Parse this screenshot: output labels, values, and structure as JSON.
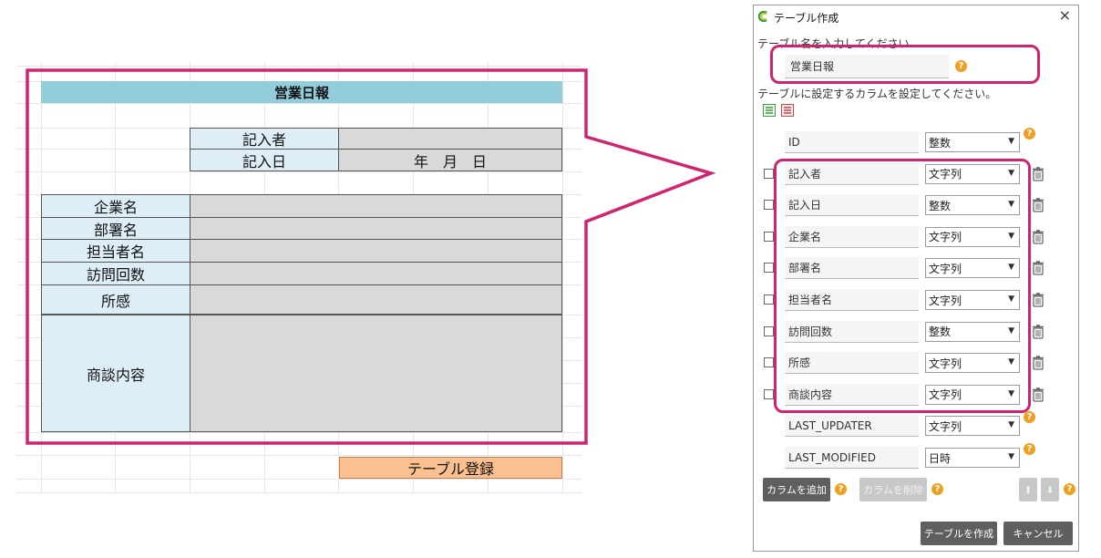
{
  "sheet": {
    "title": "営業日報",
    "recorder_label": "記入者",
    "date_label": "記入日",
    "date_value": "年　月　日",
    "rows": [
      {
        "label": "企業名"
      },
      {
        "label": "部署名"
      },
      {
        "label": "担当者名"
      },
      {
        "label": "訪問回数"
      },
      {
        "label": "所感"
      }
    ],
    "content_label": "商談内容",
    "register_button": "テーブル登録"
  },
  "dialog": {
    "title": "テーブル作成",
    "close_glyph": "×",
    "table_name_prompt": "テーブル名を入力してください",
    "table_name_value": "営業日報",
    "column_prompt": "テーブルに設定するカラムを設定してください。",
    "columns": [
      {
        "name": "ID",
        "type": "整数",
        "checkbox": false,
        "deletable": false
      },
      {
        "name": "記入者",
        "type": "文字列",
        "checkbox": true,
        "deletable": true
      },
      {
        "name": "記入日",
        "type": "整数",
        "checkbox": true,
        "deletable": true
      },
      {
        "name": "企業名",
        "type": "文字列",
        "checkbox": true,
        "deletable": true
      },
      {
        "name": "部署名",
        "type": "文字列",
        "checkbox": true,
        "deletable": true
      },
      {
        "name": "担当者名",
        "type": "文字列",
        "checkbox": true,
        "deletable": true
      },
      {
        "name": "訪問回数",
        "type": "整数",
        "checkbox": true,
        "deletable": true
      },
      {
        "name": "所感",
        "type": "文字列",
        "checkbox": true,
        "deletable": true
      },
      {
        "name": "商談内容",
        "type": "文字列",
        "checkbox": true,
        "deletable": true
      },
      {
        "name": "LAST_UPDATER",
        "type": "文字列",
        "checkbox": false,
        "deletable": false
      },
      {
        "name": "LAST_MODIFIED",
        "type": "日時",
        "checkbox": false,
        "deletable": false
      }
    ],
    "add_column_button": "カラムを追加",
    "delete_column_button": "カラムを削除",
    "create_button": "テーブルを作成",
    "cancel_button": "キャンセル",
    "help_glyph": "?",
    "select_arrow": "▼",
    "up_arrow": "⬆",
    "down_arrow": "⬇"
  },
  "colors": {
    "highlight": "#d0246e",
    "title_band": "#92cddc",
    "label_cell": "#ddeef6",
    "value_cell": "#d9d9d9",
    "register_button": "#fac090",
    "help_icon": "#f0a020",
    "dark_button": "#5f5f5f"
  }
}
